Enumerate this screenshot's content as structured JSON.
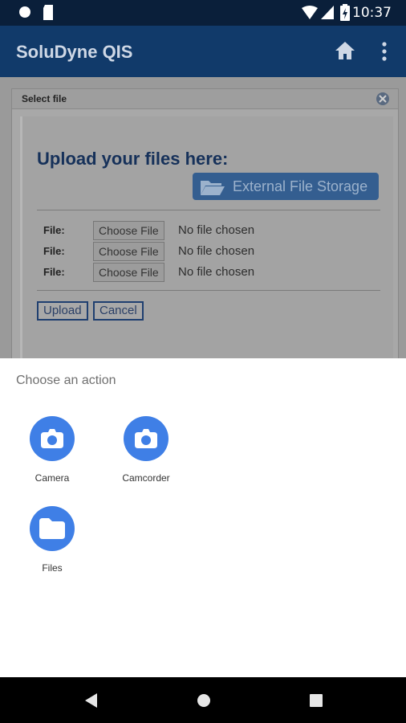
{
  "status_bar": {
    "time": "10:37"
  },
  "app_bar": {
    "title": "SoluDyne QIS"
  },
  "dialog": {
    "header": "Select file",
    "heading": "Upload your files here:",
    "external_button": "External File Storage",
    "file_rows": [
      {
        "label": "File:",
        "button": "Choose File",
        "status": "No file chosen"
      },
      {
        "label": "File:",
        "button": "Choose File",
        "status": "No file chosen"
      },
      {
        "label": "File:",
        "button": "Choose File",
        "status": "No file chosen"
      }
    ],
    "upload_button": "Upload",
    "cancel_button": "Cancel"
  },
  "sheet": {
    "title": "Choose an action",
    "apps": [
      {
        "label": "Camera",
        "icon": "camera-icon"
      },
      {
        "label": "Camcorder",
        "icon": "camera-icon"
      },
      {
        "label": "Files",
        "icon": "folder-icon"
      }
    ]
  },
  "colors": {
    "app_bar": "#113a6a",
    "status_bar": "#0a1f3a",
    "accent_blue": "#3f7fe6"
  }
}
